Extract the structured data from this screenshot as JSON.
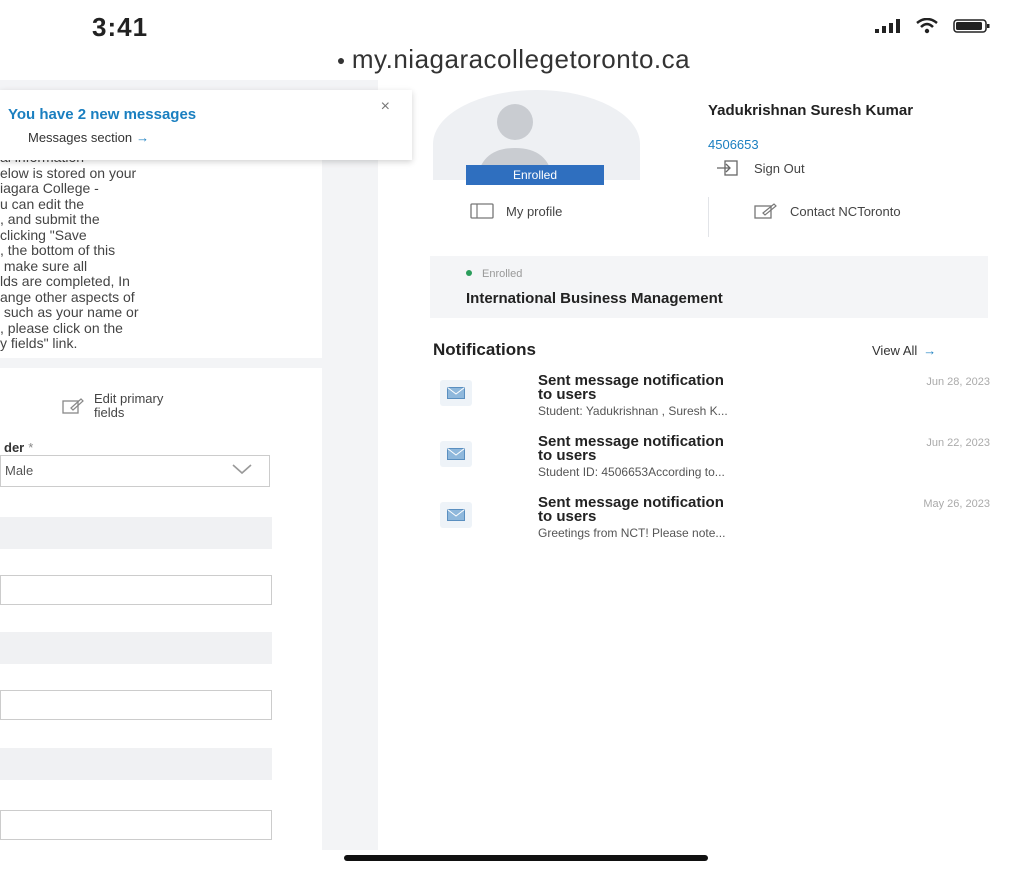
{
  "status_bar": {
    "time": "3:41",
    "url": "my.niagaracollegetoronto.ca"
  },
  "message_banner": {
    "title": "You have 2 new messages",
    "link_label": "Messages section",
    "arrow": "→",
    "close": "×"
  },
  "info": {
    "text": "al information\nelow is stored on your\niagara College -\nu can edit the\n, and submit the\nclicking \"Save\n, the bottom of this\n make sure all\nlds are completed, In\nange other aspects of\n such as your name or\n, please click on the\ny fields\" link."
  },
  "form": {
    "edit_primary_label": "Edit primary fields",
    "field_label": "der",
    "required_mark": "*",
    "select_value": "Male"
  },
  "profile": {
    "name": "Yadukrishnan Suresh Kumar",
    "id": "4506653",
    "badge": "Enrolled",
    "sign_out": "Sign Out",
    "my_profile": "My profile",
    "contact": "Contact NCToronto"
  },
  "program": {
    "status": "Enrolled",
    "name": "International Business Management"
  },
  "notifications": {
    "heading": "Notifications",
    "view_all": "View All",
    "arrow": "→",
    "items": [
      {
        "title": "Sent message notification to users",
        "date": "Jun 28, 2023",
        "preview": "Student: Yadukrishnan , Suresh K..."
      },
      {
        "title": "Sent message notification to users",
        "date": "Jun 22, 2023",
        "preview": "Student ID: 4506653According to..."
      },
      {
        "title": "Sent message notification to users",
        "date": "May 26, 2023",
        "preview": "Greetings from NCT! Please note..."
      }
    ]
  },
  "colors": {
    "accent": "#1a7fc0",
    "badge": "#2f6fbf",
    "status_dot": "#2a9d5b"
  }
}
